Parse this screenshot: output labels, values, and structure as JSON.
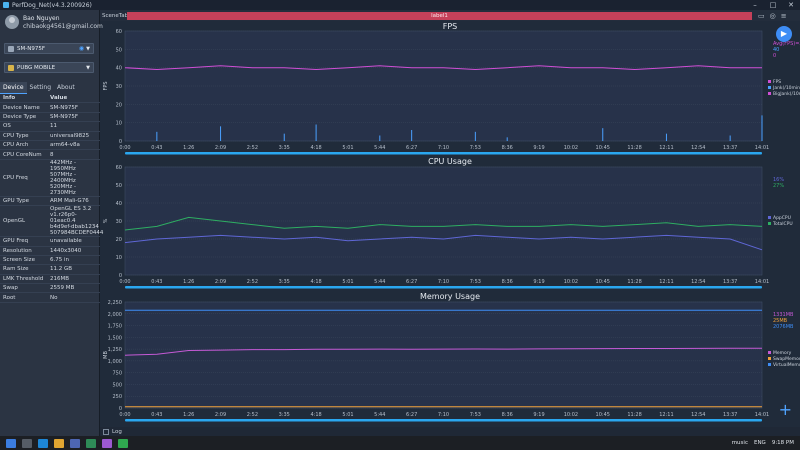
{
  "window": {
    "title": "PerfDog_Net(v4.3.200926)"
  },
  "user": {
    "name": "Bao Nguyen",
    "email": "chibaokg4561@gmail.com"
  },
  "device_select": {
    "value": "SM-N975F"
  },
  "app_select": {
    "value": "PUBG MOBILE"
  },
  "tabs": [
    "Device",
    "Setting",
    "About"
  ],
  "info_table": {
    "headers": [
      "Info",
      "Value"
    ],
    "rows": [
      [
        "Device Name",
        "SM-N975F"
      ],
      [
        "Device Type",
        "SM-N975F"
      ],
      [
        "OS",
        "11"
      ],
      [
        "CPU Type",
        "universal9825"
      ],
      [
        "CPU Arch",
        "arm64-v8a"
      ],
      [
        "CPU CoreNum",
        "8"
      ],
      [
        "CPU Freq",
        "442MHz - 1950MHz\n507MHz - 2400MHz\n520MHz - 2730MHz"
      ],
      [
        "GPU Type",
        "ARM Mali-G76"
      ],
      [
        "OpenGL",
        "OpenGL ES 3.2\nv1.r26p0-01eac0.4\nb4d9ef-dbab1234\n507984BCDEF0444"
      ],
      [
        "GPU Freq",
        "unavailable"
      ],
      [
        "Resolution",
        "1440x3040"
      ],
      [
        "Screen Size",
        "6.75 in"
      ],
      [
        "Ram Size",
        "11.2 GB"
      ],
      [
        "LMK Threshold",
        "216MB"
      ],
      [
        "Swap",
        "2559 MB"
      ],
      [
        "Root",
        "No"
      ]
    ]
  },
  "scene": {
    "label": "SceneTab",
    "track": "label1"
  },
  "time_ticks": [
    "0:00",
    "0:43",
    "1:26",
    "2:09",
    "2:52",
    "3:35",
    "4:18",
    "5:01",
    "5:44",
    "6:27",
    "7:10",
    "7:53",
    "8:36",
    "9:19",
    "10:02",
    "10:45",
    "11:28",
    "12:11",
    "12:54",
    "13:37",
    "14:01"
  ],
  "log_label": "Log",
  "taskbar": {
    "tray_text": "music",
    "lang": "ENG",
    "time": "9:18 PM"
  },
  "colors": {
    "fps": "#d04fd6",
    "cpu_app": "#5f67d6",
    "cpu_total": "#2eae62",
    "memory": "#c55ad6",
    "accent": "#3e8df5"
  },
  "chart_data": [
    {
      "type": "line",
      "title": "FPS",
      "ylabel": "FPS",
      "ylim": [
        0,
        60
      ],
      "yticks": [
        "0",
        "10",
        "20",
        "30",
        "40",
        "50",
        "60"
      ],
      "series": [
        {
          "name": "FPS",
          "values": [
            40,
            39,
            40,
            41,
            40,
            40,
            39,
            40,
            41,
            40,
            40,
            39,
            40,
            41,
            40,
            40,
            39,
            40,
            41,
            40,
            40
          ]
        },
        {
          "name": "Jank(/10min)",
          "values": [
            0,
            5,
            0,
            8,
            0,
            4,
            9,
            0,
            3,
            6,
            0,
            5,
            2,
            0,
            0,
            7,
            0,
            4,
            0,
            3,
            14
          ]
        }
      ],
      "legend": [
        "FPS",
        "Jank(/10min)",
        "BigJank(/10min)"
      ],
      "labels": [
        "Avg(FPS)=39.7",
        "40",
        "0"
      ]
    },
    {
      "type": "line",
      "title": "CPU Usage",
      "ylabel": "%",
      "ylim": [
        0,
        60
      ],
      "yticks": [
        "0",
        "10",
        "20",
        "30",
        "40",
        "50",
        "60"
      ],
      "series": [
        {
          "name": "AppCPU",
          "values": [
            18,
            20,
            21,
            22,
            21,
            20,
            21,
            19,
            20,
            21,
            20,
            22,
            21,
            20,
            21,
            20,
            21,
            22,
            21,
            20,
            14
          ]
        },
        {
          "name": "TotalCPU",
          "values": [
            25,
            27,
            32,
            30,
            28,
            26,
            27,
            26,
            28,
            27,
            27,
            28,
            27,
            27,
            28,
            27,
            28,
            29,
            27,
            28,
            27
          ]
        }
      ],
      "legend": [
        "AppCPU",
        "TotalCPU"
      ],
      "labels": [
        "16%",
        "27%"
      ]
    },
    {
      "type": "line",
      "title": "Memory Usage",
      "ylabel": "MB",
      "ylim": [
        0,
        2250
      ],
      "yticks": [
        "0",
        "250",
        "500",
        "750",
        "1,000",
        "1,250",
        "1,500",
        "1,750",
        "2,000",
        "2,250"
      ],
      "series": [
        {
          "name": "Memory",
          "values": [
            1120,
            1140,
            1220,
            1230,
            1240,
            1240,
            1245,
            1245,
            1250,
            1248,
            1250,
            1252,
            1250,
            1255,
            1258,
            1260,
            1262,
            1263,
            1265,
            1268,
            1269
          ]
        },
        {
          "name": "SwapMemory",
          "values": [
            25,
            25,
            25,
            25,
            25,
            25,
            25,
            25,
            25,
            25,
            25,
            25,
            25,
            25,
            25,
            25,
            25,
            25,
            25,
            25,
            25
          ]
        },
        {
          "name": "VirtualMemory",
          "values": [
            2075,
            2075,
            2076,
            2076,
            2076,
            2077,
            2077,
            2077,
            2077,
            2077,
            2077,
            2077,
            2077,
            2077,
            2077,
            2077,
            2077,
            2077,
            2077,
            2077,
            2077
          ]
        }
      ],
      "legend": [
        "Memory",
        "SwapMemory",
        "VirtualMemory"
      ],
      "labels": [
        "1331MB",
        "25MB",
        "2076MB"
      ]
    }
  ]
}
